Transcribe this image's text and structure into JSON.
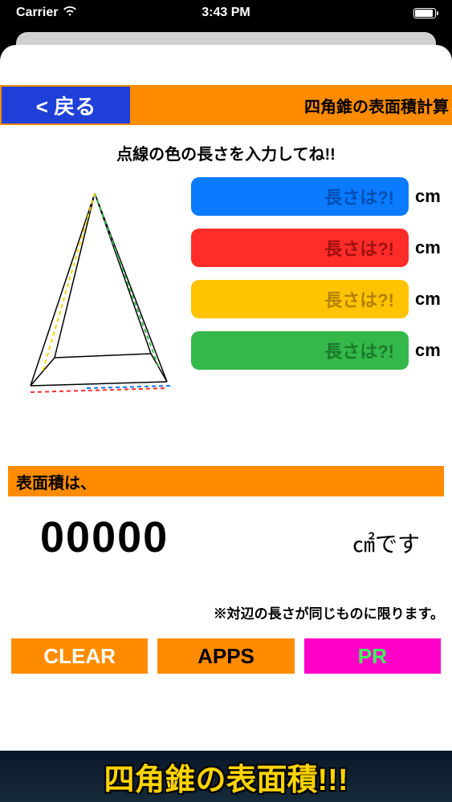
{
  "status": {
    "carrier": "Carrier",
    "time": "3:43 PM"
  },
  "header": {
    "back": "< 戻る",
    "title": "四角錐の表面積計算"
  },
  "instruction": "点線の色の長さを入力してね!!",
  "inputs": {
    "placeholder": "長さは?!",
    "unit": "cm"
  },
  "result": {
    "label": "表面積は、",
    "value": "00000",
    "unit": "㎠です"
  },
  "note": "※対辺の長さが同じものに限ります。",
  "buttons": {
    "clear": "CLEAR",
    "apps": "APPS",
    "pr": "PR"
  },
  "banner": "四角錐の表面積!!!"
}
